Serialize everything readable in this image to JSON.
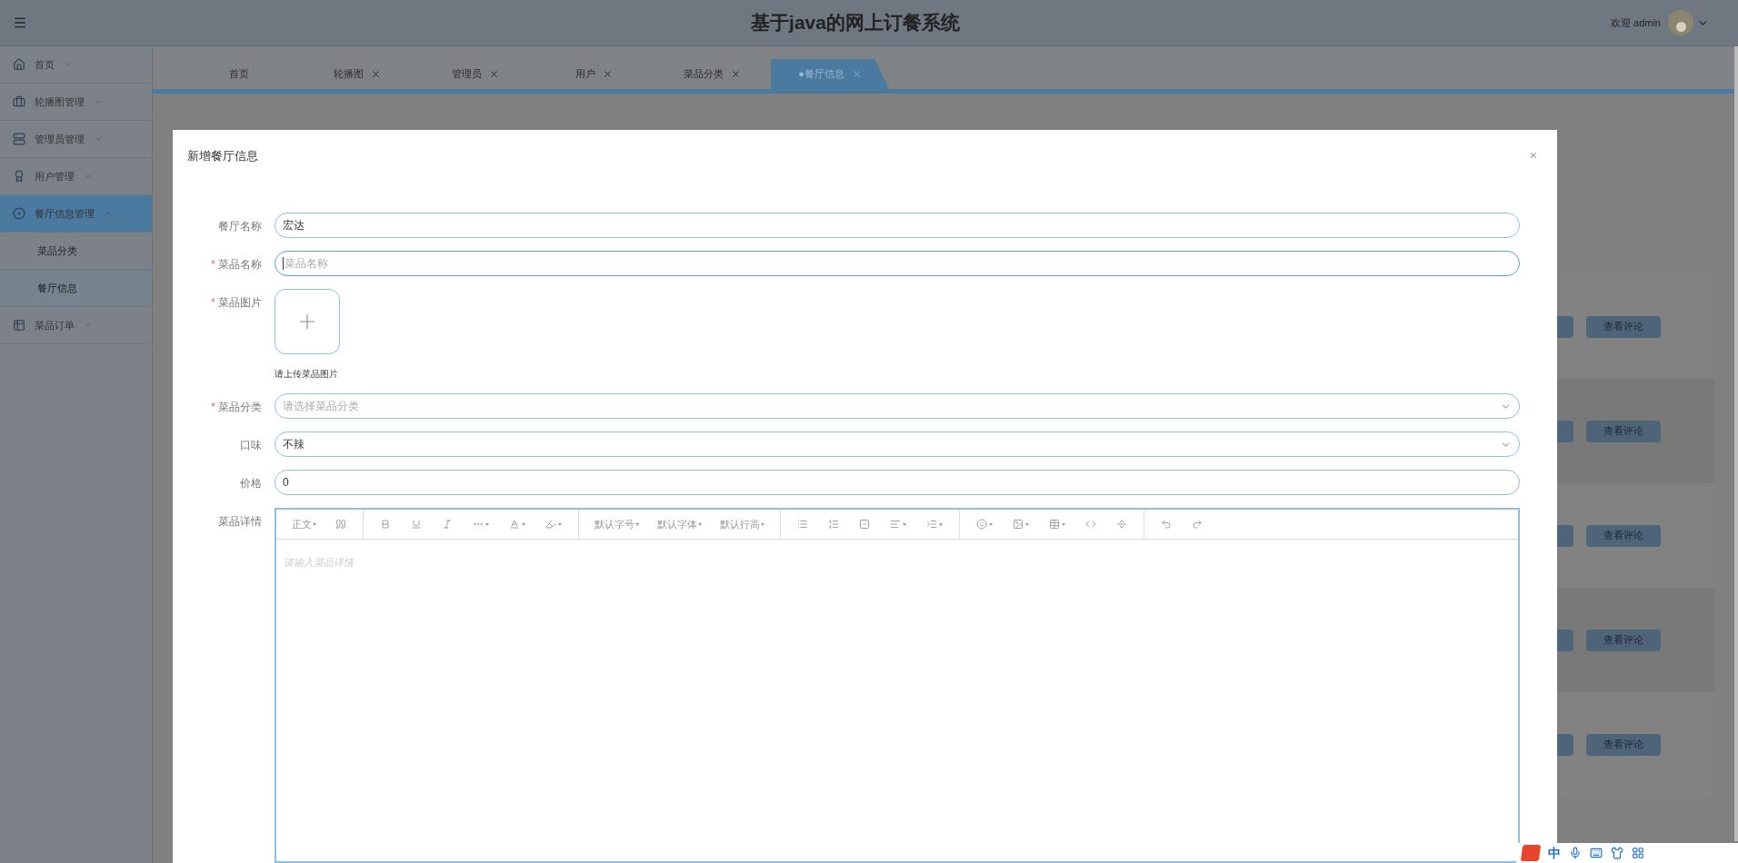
{
  "header": {
    "title": "基于java的网上订餐系统",
    "welcome": "欢迎 admin"
  },
  "sidebar": {
    "items": [
      {
        "label": "首页",
        "expanded": false,
        "selected": false
      },
      {
        "label": "轮播图管理",
        "expanded": false,
        "selected": false
      },
      {
        "label": "管理员管理",
        "expanded": false,
        "selected": false
      },
      {
        "label": "用户管理",
        "expanded": false,
        "selected": false
      },
      {
        "label": "餐厅信息管理",
        "expanded": true,
        "selected": true,
        "children": [
          {
            "label": "菜品分类",
            "selected": false
          },
          {
            "label": "餐厅信息",
            "selected": true
          }
        ]
      },
      {
        "label": "菜品订单",
        "expanded": false,
        "selected": false
      }
    ]
  },
  "tabs": [
    {
      "label": "首页",
      "closable": false,
      "selected": false
    },
    {
      "label": "轮播图",
      "closable": true,
      "selected": false
    },
    {
      "label": "管理员",
      "closable": true,
      "selected": false
    },
    {
      "label": "用户",
      "closable": true,
      "selected": false
    },
    {
      "label": "菜品分类",
      "closable": true,
      "selected": false
    },
    {
      "label": "●餐厅信息",
      "closable": true,
      "selected": true
    }
  ],
  "table": {
    "rows": [
      {
        "action": "查看评论"
      },
      {
        "action": "查看评论"
      },
      {
        "action": "查看评论"
      },
      {
        "action": "查看评论"
      },
      {
        "action": "查看评论"
      }
    ]
  },
  "modal": {
    "title": "新增餐厅信息",
    "close": "×",
    "fields": [
      {
        "kind": "text",
        "label": "餐厅名称",
        "value": "宏达"
      },
      {
        "kind": "text",
        "label": "菜品名称",
        "required_mark": "*",
        "placeholder": "菜品名称",
        "focused": true
      },
      {
        "kind": "upload",
        "label": "菜品图片",
        "required_mark": "*",
        "hint": "请上传菜品图片"
      },
      {
        "kind": "select",
        "label": "菜品分类",
        "required_mark": "*",
        "placeholder": "请选择菜品分类"
      },
      {
        "kind": "select",
        "label": "口味",
        "value": "不辣"
      },
      {
        "kind": "text",
        "label": "价格",
        "value": "0"
      },
      {
        "kind": "editor",
        "label": "菜品详情",
        "placeholder": "请输入菜品详情",
        "toolbar": [
          [
            {
              "kind": "text",
              "label": "正文",
              "dropdown": true
            },
            {
              "kind": "icon",
              "dropdown": false
            }
          ],
          [
            {
              "kind": "icon",
              "dropdown": false
            },
            {
              "kind": "icon",
              "dropdown": false
            },
            {
              "kind": "icon",
              "dropdown": false
            },
            {
              "kind": "icon",
              "dropdown": true
            },
            {
              "kind": "icon",
              "dropdown": true
            },
            {
              "kind": "icon",
              "dropdown": true
            }
          ],
          [
            {
              "kind": "text",
              "label": "默认字号",
              "dropdown": true
            },
            {
              "kind": "text",
              "label": "默认字体",
              "dropdown": true
            },
            {
              "kind": "text",
              "label": "默认行高",
              "dropdown": true
            }
          ],
          [
            {
              "kind": "icon",
              "dropdown": false
            },
            {
              "kind": "icon",
              "dropdown": false
            },
            {
              "kind": "icon",
              "dropdown": false
            },
            {
              "kind": "icon",
              "dropdown": true
            },
            {
              "kind": "icon",
              "dropdown": true
            }
          ],
          [
            {
              "kind": "icon",
              "dropdown": true
            },
            {
              "kind": "icon",
              "dropdown": true
            },
            {
              "kind": "icon",
              "dropdown": true
            },
            {
              "kind": "icon",
              "dropdown": false
            },
            {
              "kind": "icon",
              "dropdown": false
            }
          ],
          [
            {
              "kind": "icon",
              "dropdown": false
            },
            {
              "kind": "icon",
              "dropdown": false
            }
          ]
        ]
      }
    ]
  },
  "ime_toolbar": {
    "mode": "中"
  }
}
